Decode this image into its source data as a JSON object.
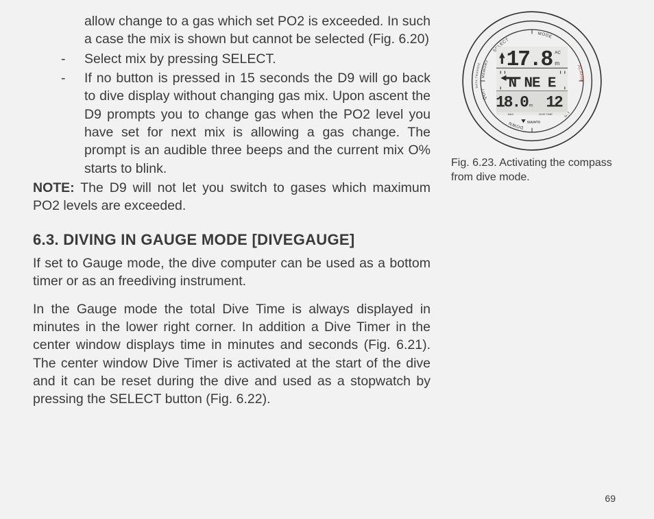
{
  "main": {
    "intro_cont": "allow change to a gas which set PO2 is exceeded. In such a case the mix is shown but cannot be selected (Fig. 6.20)",
    "bullets": {
      "dash": "-",
      "b1": "Select mix by pressing SELECT.",
      "b2": "If no button is pressed in 15 seconds the D9 will go back to dive display without changing gas mix. Upon ascent the D9 prompts you to change gas when the PO2 level you have set for next mix is allowing a gas change.  The prompt is an audible three beeps and the current mix O% starts to blink."
    },
    "note_label": "NOTE:",
    "note_text": "  The D9 will not let you switch to gases which maxi­mum PO2 levels are exceeded.",
    "heading": "6.3. DIVING IN GAUGE MODE [DIVEGAUGE]",
    "p1": "If set to Gauge mode, the dive computer can be used as a bottom timer or as an freediving instrument.",
    "p2": "In the Gauge mode the total Dive Time is always displayed in minutes in the lower right corner. In addition a Dive Timer in the center window displays time in minutes and seconds (Fig. 6.21). The center window Dive Timer is activated at the start of the dive and it can be reset during the dive and used as a stopwatch by pressing the SELECT button (Fig. 6.22)."
  },
  "figure": {
    "caption": "Fig. 6.23. Activating the compass from dive mode.",
    "watch": {
      "depth": "17.8",
      "depth_unit": "m",
      "ac": "AC",
      "compass_letters": "N   NE E",
      "max_depth": "18.0",
      "max_depth_unit": "m",
      "dive_time": "12",
      "max_label": "MAX",
      "divetime_label": "DIVE TIME",
      "brand": "SUUNTO",
      "ring": {
        "select": "SELECT",
        "mode": "MODE",
        "alarm": "ALARM",
        "up": "UP",
        "down": "DOWN",
        "quit": "QUIT",
        "memory": "MEMORY",
        "data_transfer": "DATA TRANSFER"
      }
    }
  },
  "page_number": "69"
}
